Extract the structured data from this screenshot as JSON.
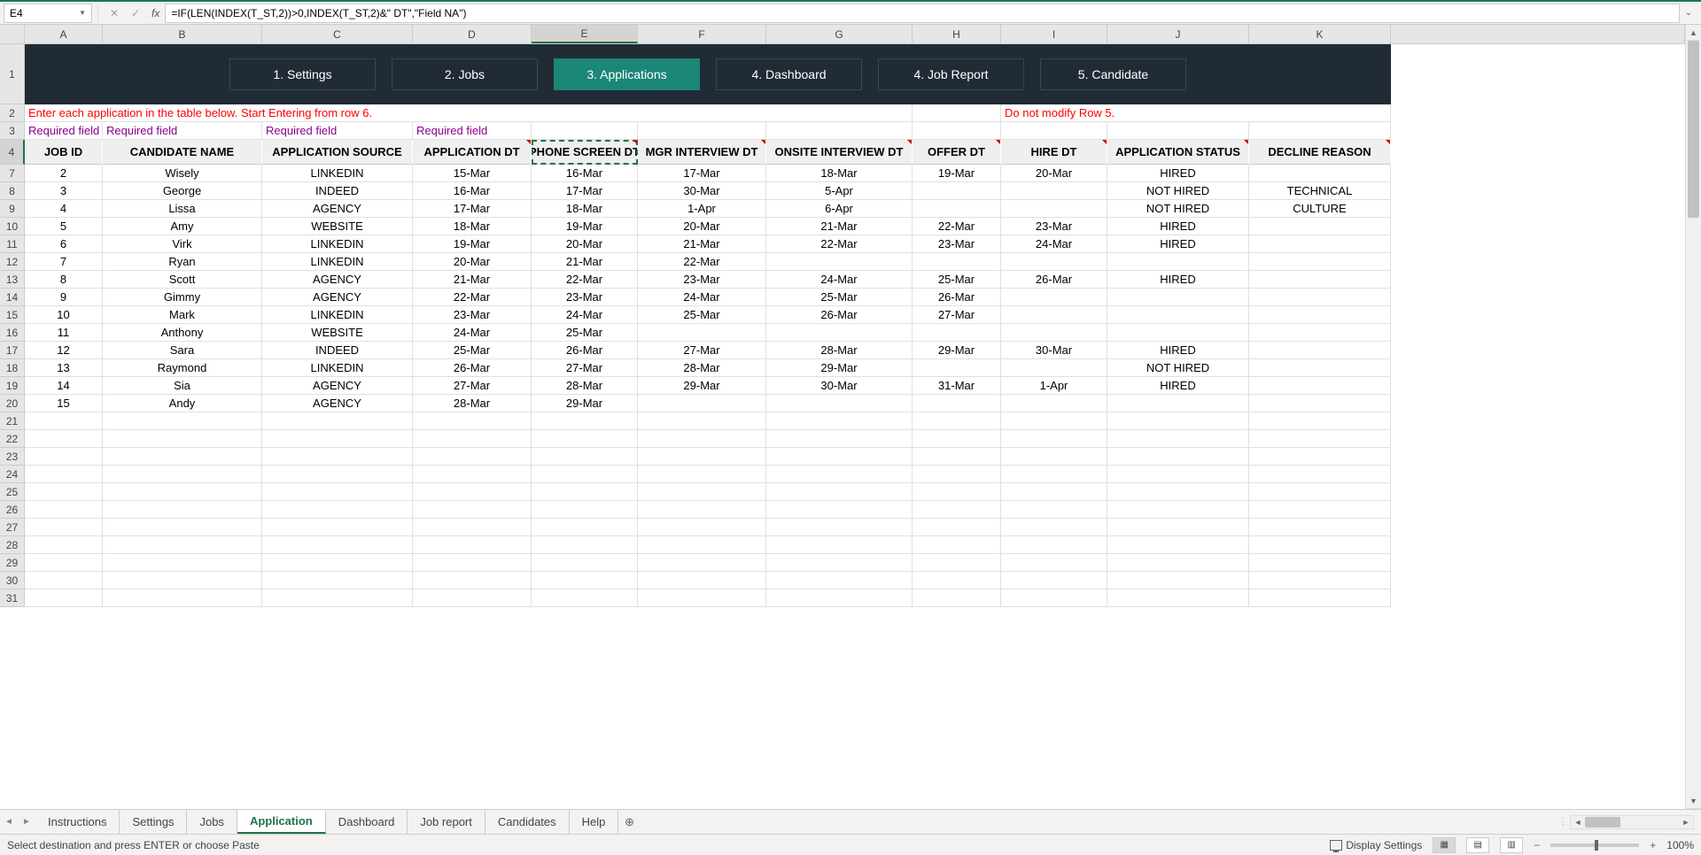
{
  "formula_bar": {
    "cell_ref": "E4",
    "formula": "=IF(LEN(INDEX(T_ST,2))>0,INDEX(T_ST,2)&\" DT\",\"Field NA\")"
  },
  "columns": [
    "A",
    "B",
    "C",
    "D",
    "E",
    "F",
    "G",
    "H",
    "I",
    "J",
    "K"
  ],
  "selected_col": "E",
  "nav_buttons": [
    "1. Settings",
    "2. Jobs",
    "3. Applications",
    "4. Dashboard",
    "4. Job Report",
    "5. Candidate"
  ],
  "nav_active": 2,
  "instruction_row2": "Enter each application in the table below. Start Entering from row 6.",
  "instruction_row2_right": "Do not modify Row 5.",
  "required_fields": {
    "A": "Required field",
    "B": "Required field",
    "C": "Required field",
    "D": "Required field"
  },
  "headers": [
    "JOB ID",
    "CANDIDATE NAME",
    "APPLICATION SOURCE",
    "APPLICATION DT",
    "PHONE SCREEN DT",
    "MGR INTERVIEW DT",
    "ONSITE INTERVIEW DT",
    "OFFER DT",
    "HIRE DT",
    "APPLICATION STATUS",
    "DECLINE REASON"
  ],
  "header_indicators": [
    false,
    false,
    false,
    true,
    true,
    true,
    true,
    true,
    true,
    true,
    true
  ],
  "data_rows": [
    {
      "n": 7,
      "c": [
        "2",
        "Wisely",
        "LINKEDIN",
        "15-Mar",
        "16-Mar",
        "17-Mar",
        "18-Mar",
        "19-Mar",
        "20-Mar",
        "HIRED",
        ""
      ]
    },
    {
      "n": 8,
      "c": [
        "3",
        "George",
        "INDEED",
        "16-Mar",
        "17-Mar",
        "30-Mar",
        "5-Apr",
        "",
        "",
        "NOT HIRED",
        "TECHNICAL"
      ]
    },
    {
      "n": 9,
      "c": [
        "4",
        "Lissa",
        "AGENCY",
        "17-Mar",
        "18-Mar",
        "1-Apr",
        "6-Apr",
        "",
        "",
        "NOT HIRED",
        "CULTURE"
      ]
    },
    {
      "n": 10,
      "c": [
        "5",
        "Amy",
        "WEBSITE",
        "18-Mar",
        "19-Mar",
        "20-Mar",
        "21-Mar",
        "22-Mar",
        "23-Mar",
        "HIRED",
        ""
      ]
    },
    {
      "n": 11,
      "c": [
        "6",
        "Virk",
        "LINKEDIN",
        "19-Mar",
        "20-Mar",
        "21-Mar",
        "22-Mar",
        "23-Mar",
        "24-Mar",
        "HIRED",
        ""
      ]
    },
    {
      "n": 12,
      "c": [
        "7",
        "Ryan",
        "LINKEDIN",
        "20-Mar",
        "21-Mar",
        "22-Mar",
        "",
        "",
        "",
        "",
        ""
      ]
    },
    {
      "n": 13,
      "c": [
        "8",
        "Scott",
        "AGENCY",
        "21-Mar",
        "22-Mar",
        "23-Mar",
        "24-Mar",
        "25-Mar",
        "26-Mar",
        "HIRED",
        ""
      ]
    },
    {
      "n": 14,
      "c": [
        "9",
        "Gimmy",
        "AGENCY",
        "22-Mar",
        "23-Mar",
        "24-Mar",
        "25-Mar",
        "26-Mar",
        "",
        "",
        ""
      ]
    },
    {
      "n": 15,
      "c": [
        "10",
        "Mark",
        "LINKEDIN",
        "23-Mar",
        "24-Mar",
        "25-Mar",
        "26-Mar",
        "27-Mar",
        "",
        "",
        ""
      ]
    },
    {
      "n": 16,
      "c": [
        "11",
        "Anthony",
        "WEBSITE",
        "24-Mar",
        "25-Mar",
        "",
        "",
        "",
        "",
        "",
        ""
      ]
    },
    {
      "n": 17,
      "c": [
        "12",
        "Sara",
        "INDEED",
        "25-Mar",
        "26-Mar",
        "27-Mar",
        "28-Mar",
        "29-Mar",
        "30-Mar",
        "HIRED",
        ""
      ]
    },
    {
      "n": 18,
      "c": [
        "13",
        "Raymond",
        "LINKEDIN",
        "26-Mar",
        "27-Mar",
        "28-Mar",
        "29-Mar",
        "",
        "",
        "NOT HIRED",
        ""
      ]
    },
    {
      "n": 19,
      "c": [
        "14",
        "Sia",
        "AGENCY",
        "27-Mar",
        "28-Mar",
        "29-Mar",
        "30-Mar",
        "31-Mar",
        "1-Apr",
        "HIRED",
        ""
      ]
    },
    {
      "n": 20,
      "c": [
        "15",
        "Andy",
        "AGENCY",
        "28-Mar",
        "29-Mar",
        "",
        "",
        "",
        "",
        "",
        ""
      ]
    }
  ],
  "empty_rows": [
    21,
    22,
    23,
    24,
    25,
    26,
    27,
    28,
    29,
    30,
    31
  ],
  "sheet_tabs": [
    "Instructions",
    "Settings",
    "Jobs",
    "Application",
    "Dashboard",
    "Job report",
    "Candidates",
    "Help"
  ],
  "sheet_active": 3,
  "status_text": "Select destination and press ENTER or choose Paste",
  "display_settings_label": "Display Settings",
  "zoom_label": "100%"
}
